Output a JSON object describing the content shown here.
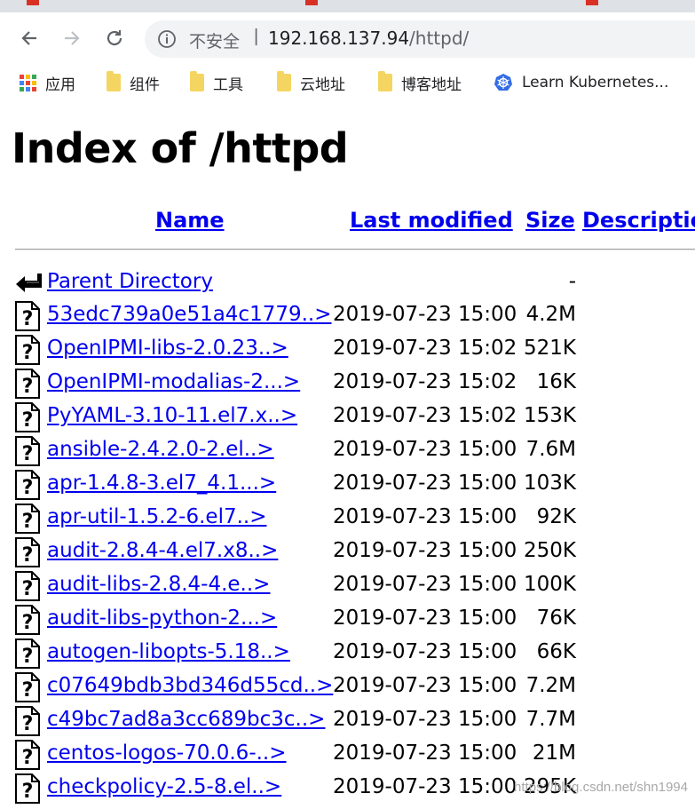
{
  "browser": {
    "back_icon": "arrow-left-icon",
    "forward_icon": "arrow-right-icon",
    "reload_icon": "reload-icon",
    "security_label": "不安全",
    "separator": "|",
    "url_host": "192.168.137.94",
    "url_path": "/httpd/"
  },
  "bookmarks": [
    {
      "label": "应用",
      "icon": "apps-grid-icon"
    },
    {
      "label": "组件",
      "icon": "folder-icon"
    },
    {
      "label": "工具",
      "icon": "folder-icon"
    },
    {
      "label": "云地址",
      "icon": "folder-icon"
    },
    {
      "label": "博客地址",
      "icon": "folder-icon"
    },
    {
      "label": "Learn Kubernetes...",
      "icon": "kubernetes-icon"
    }
  ],
  "page": {
    "title": "Index of /httpd",
    "columns": {
      "name": "Name",
      "last_modified": "Last modified",
      "size": "Size",
      "description": "Description"
    },
    "parent": {
      "name": "Parent Directory",
      "size": "-"
    },
    "rows": [
      {
        "name": "53edc739a0e51a4c1779..>",
        "date": "2019-07-23 15:00",
        "size": "4.2M"
      },
      {
        "name": "OpenIPMI-libs-2.0.23..>",
        "date": "2019-07-23 15:02",
        "size": "521K"
      },
      {
        "name": "OpenIPMI-modalias-2...>",
        "date": "2019-07-23 15:02",
        "size": "16K"
      },
      {
        "name": "PyYAML-3.10-11.el7.x..>",
        "date": "2019-07-23 15:02",
        "size": "153K"
      },
      {
        "name": "ansible-2.4.2.0-2.el..>",
        "date": "2019-07-23 15:00",
        "size": "7.6M"
      },
      {
        "name": "apr-1.4.8-3.el7_4.1...>",
        "date": "2019-07-23 15:00",
        "size": "103K"
      },
      {
        "name": "apr-util-1.5.2-6.el7..>",
        "date": "2019-07-23 15:00",
        "size": "92K"
      },
      {
        "name": "audit-2.8.4-4.el7.x8..>",
        "date": "2019-07-23 15:00",
        "size": "250K"
      },
      {
        "name": "audit-libs-2.8.4-4.e..>",
        "date": "2019-07-23 15:00",
        "size": "100K"
      },
      {
        "name": "audit-libs-python-2...>",
        "date": "2019-07-23 15:00",
        "size": "76K"
      },
      {
        "name": "autogen-libopts-5.18..>",
        "date": "2019-07-23 15:00",
        "size": "66K"
      },
      {
        "name": "c07649bdb3bd346d55cd..>",
        "date": "2019-07-23 15:00",
        "size": "7.2M"
      },
      {
        "name": "c49bc7ad8a3cc689bc3c..>",
        "date": "2019-07-23 15:00",
        "size": "7.7M"
      },
      {
        "name": "centos-logos-70.0.6-..>",
        "date": "2019-07-23 15:00",
        "size": "21M"
      },
      {
        "name": "checkpolicy-2.5-8.el..>",
        "date": "2019-07-23 15:00",
        "size": "295K"
      }
    ]
  },
  "watermark": "https://blog.csdn.net/shn1994",
  "colors": {
    "link": "#0000ee",
    "omnibox_bg": "#f1f3f4",
    "tabstrip_bg": "#dee1e6",
    "folder": "#f5d561"
  }
}
